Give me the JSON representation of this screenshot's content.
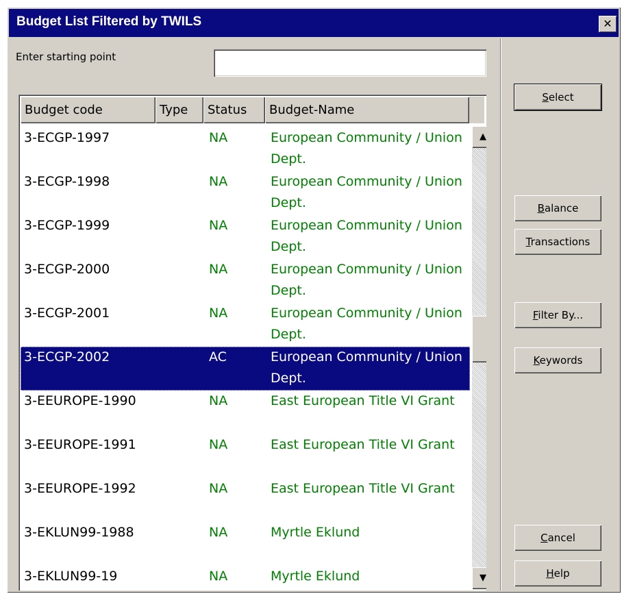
{
  "dialog": {
    "title": "Budget List Filtered by TWILS",
    "close_glyph": "✕"
  },
  "search": {
    "label": "Enter starting point",
    "value": "",
    "placeholder": ""
  },
  "table": {
    "columns": [
      "Budget code",
      "Type",
      "Status",
      "Budget-Name"
    ],
    "rows": [
      {
        "code": "3-ECGP-1997",
        "type": "",
        "status": "NA",
        "name": "European Community / Union Dept.",
        "selected": false
      },
      {
        "code": "3-ECGP-1998",
        "type": "",
        "status": "NA",
        "name": "European Community / Union Dept.",
        "selected": false
      },
      {
        "code": "3-ECGP-1999",
        "type": "",
        "status": "NA",
        "name": "European Community / Union Dept.",
        "selected": false
      },
      {
        "code": "3-ECGP-2000",
        "type": "",
        "status": "NA",
        "name": "European Community / Union Dept.",
        "selected": false
      },
      {
        "code": "3-ECGP-2001",
        "type": "",
        "status": "NA",
        "name": "European Community / Union Dept.",
        "selected": false
      },
      {
        "code": "3-ECGP-2002",
        "type": "",
        "status": "AC",
        "name": "European Community / Union Dept.",
        "selected": true
      },
      {
        "code": "3-EEUROPE-1990",
        "type": "",
        "status": "NA",
        "name": "East European Title VI Grant",
        "selected": false
      },
      {
        "code": "3-EEUROPE-1991",
        "type": "",
        "status": "NA",
        "name": "East European Title VI Grant",
        "selected": false
      },
      {
        "code": "3-EEUROPE-1992",
        "type": "",
        "status": "NA",
        "name": "East European Title VI Grant",
        "selected": false
      },
      {
        "code": "3-EKLUN99-1988",
        "type": "",
        "status": "NA",
        "name": "Myrtle Eklund",
        "selected": false
      },
      {
        "code": "3-EKLUN99-19",
        "type": "",
        "status": "NA",
        "name": "Myrtle Eklund",
        "selected": false
      }
    ]
  },
  "scrollbar": {
    "up_glyph": "▲",
    "down_glyph": "▼",
    "position": 0.45
  },
  "buttons": {
    "select": {
      "accel": "S",
      "rest": "elect"
    },
    "balance": {
      "accel": "B",
      "rest": "alance"
    },
    "transactions": {
      "accel": "T",
      "rest": "ransactions"
    },
    "filter_by": {
      "accel": "F",
      "rest": "ilter By..."
    },
    "keywords": {
      "accel": "K",
      "rest": "eywords"
    },
    "cancel": {
      "accel": "C",
      "rest": "ancel"
    },
    "help": {
      "accel": "H",
      "rest": "elp"
    }
  },
  "colors": {
    "title_bar": "#0a0a80",
    "selection": "#0a0a80",
    "name_text": "#008000",
    "face": "#d4d0c8"
  }
}
